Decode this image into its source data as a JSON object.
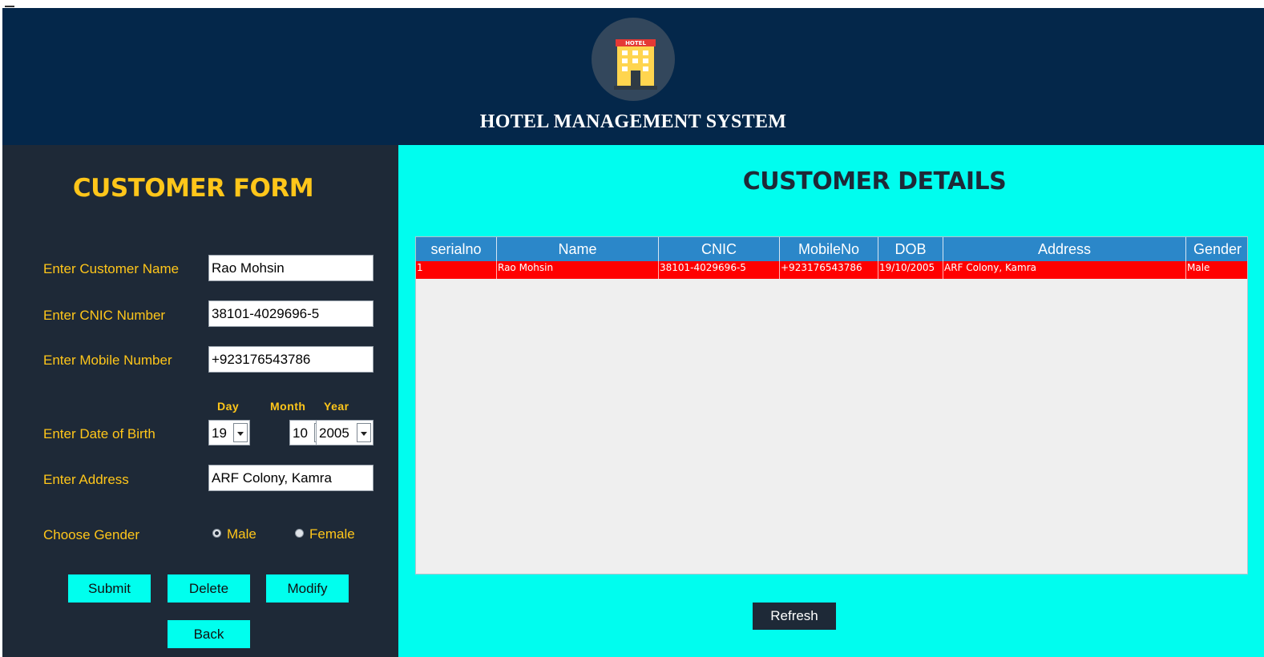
{
  "header": {
    "title": "HOTEL MANAGEMENT SYSTEM",
    "logo_text": "HOTEL",
    "logo_icon": "hotel-building-icon"
  },
  "form": {
    "title": "CUSTOMER FORM",
    "name_label": "Enter Customer Name",
    "name_value": "Rao Mohsin",
    "cnic_label": "Enter CNIC Number",
    "cnic_value": "38101-4029696-5",
    "mobile_label": "Enter Mobile Number",
    "mobile_value": "+923176543786",
    "dob_label": "Enter Date of Birth",
    "day_label": "Day",
    "month_label": "Month",
    "year_label": "Year",
    "day_value": "19",
    "month_value": "10",
    "year_value": "2005",
    "address_label": "Enter Address",
    "address_value": "ARF Colony, Kamra",
    "gender_label": "Choose Gender",
    "gender_male": "Male",
    "gender_female": "Female",
    "gender_selected": "Male",
    "buttons": {
      "submit": "Submit",
      "delete": "Delete",
      "modify": "Modify",
      "back": "Back"
    }
  },
  "details": {
    "title": "CUSTOMER DETAILS",
    "columns": [
      "serialno",
      "Name",
      "CNIC",
      "MobileNo",
      "DOB",
      "Address",
      "Gender"
    ],
    "rows": [
      [
        "1",
        "Rao Mohsin",
        "38101-4029696-5",
        "+923176543786",
        "19/10/2005",
        "ARF Colony, Kamra",
        "Male"
      ]
    ],
    "refresh_label": "Refresh"
  },
  "colors": {
    "header_bg": "#04274a",
    "form_bg": "#1e2937",
    "accent_yellow": "#ffc61a",
    "details_bg": "#00fdef",
    "table_header": "#2b87c9",
    "selected_row": "#ff0000",
    "button_cyan": "#00ffee"
  }
}
